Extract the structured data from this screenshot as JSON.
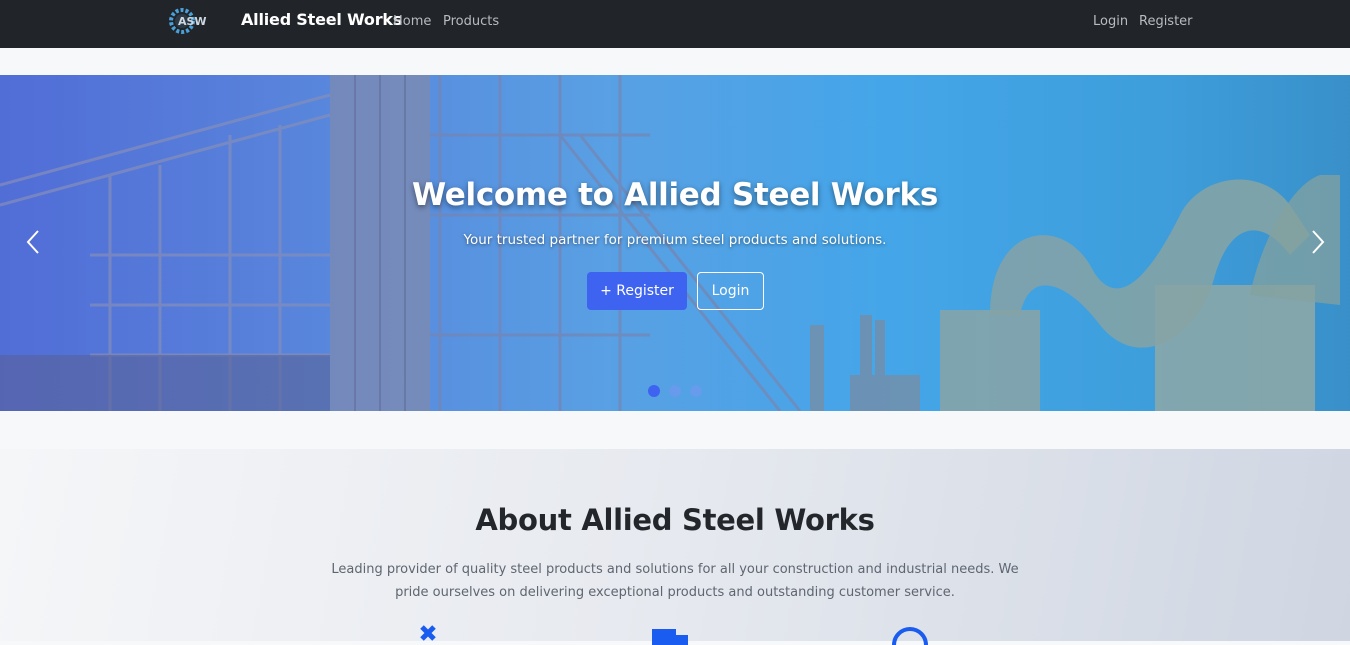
{
  "nav": {
    "logo_text": "ASW",
    "brand": "Allied Steel Works",
    "links": [
      "Home",
      "Products"
    ],
    "login": "Login",
    "register": "Register"
  },
  "hero": {
    "title": "Welcome to Allied Steel Works",
    "subtitle": "Your trusted partner for premium steel products and solutions.",
    "register_button": "+ Register",
    "login_button": "Login",
    "slide_count": 3,
    "active_slide": 1
  },
  "about": {
    "title": "About Allied Steel Works",
    "text": "Leading provider of quality steel products and solutions for all your construction and industrial needs. We pride ourselves on delivering exceptional products and outstanding customer service.",
    "icons": [
      "tools-icon",
      "truck-icon",
      "clock-icon"
    ]
  },
  "colors": {
    "navbar": "#212529",
    "accent": "#3d63f0",
    "icon_blue": "#1a5cf0"
  }
}
